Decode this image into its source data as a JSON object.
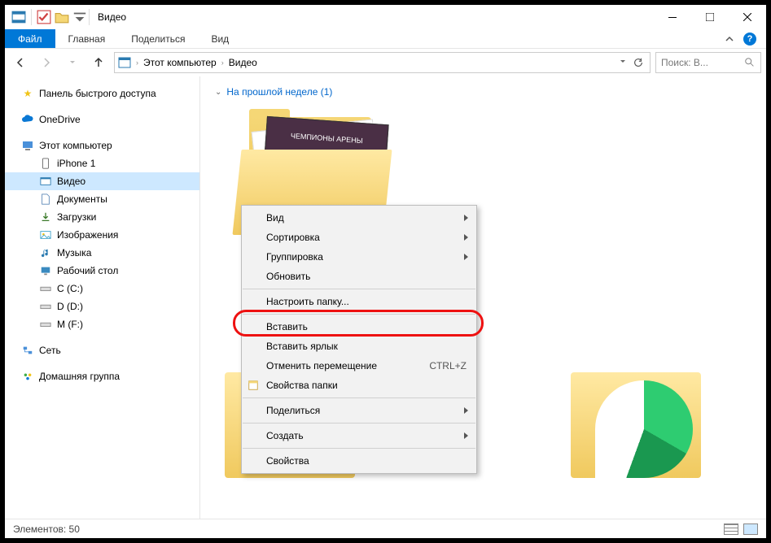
{
  "title": "Видео",
  "ribbon": {
    "file": "Файл",
    "tabs": [
      "Главная",
      "Поделиться",
      "Вид"
    ]
  },
  "breadcrumb": {
    "root": "Этот компьютер",
    "current": "Видео"
  },
  "search": {
    "placeholder": "Поиск: В..."
  },
  "sidebar": {
    "quick_access": "Панель быстрого доступа",
    "onedrive": "OneDrive",
    "this_pc": "Этот компьютер",
    "items": [
      "iPhone 1",
      "Видео",
      "Документы",
      "Загрузки",
      "Изображения",
      "Музыка",
      "Рабочий стол",
      "C (C:)",
      "D (D:)",
      "M (F:)"
    ],
    "network": "Сеть",
    "homegroup": "Домашняя группа"
  },
  "group_header": "На прошлой неделе (1)",
  "folder_caption": "ЧЕМПИОНЫ АРЕНЫ",
  "context_menu": {
    "items": [
      {
        "label": "Вид",
        "sub": true
      },
      {
        "label": "Сортировка",
        "sub": true
      },
      {
        "label": "Группировка",
        "sub": true
      },
      {
        "label": "Обновить"
      },
      {
        "sep": true
      },
      {
        "label": "Настроить папку..."
      },
      {
        "sep": true
      },
      {
        "label": "Вставить",
        "hl": true
      },
      {
        "label": "Вставить ярлык"
      },
      {
        "label": "Отменить перемещение",
        "shortcut": "CTRL+Z"
      },
      {
        "label": "Свойства папки",
        "icon": "props"
      },
      {
        "sep": true
      },
      {
        "label": "Поделиться",
        "sub": true
      },
      {
        "sep": true
      },
      {
        "label": "Создать",
        "sub": true
      },
      {
        "sep": true
      },
      {
        "label": "Свойства"
      }
    ]
  },
  "status": {
    "items": "Элементов: 50"
  }
}
